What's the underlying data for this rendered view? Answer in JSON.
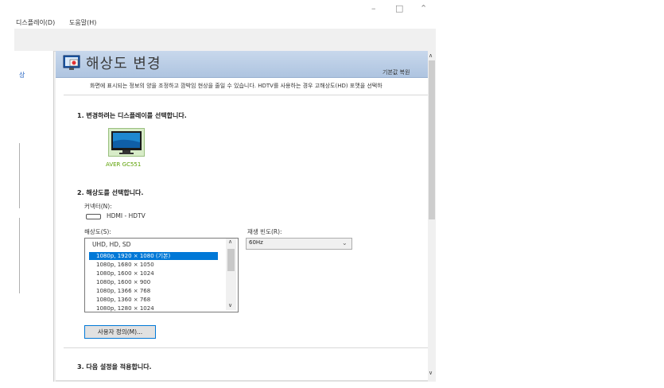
{
  "window": {
    "minimize": "–",
    "maximize": "□",
    "close": "⌃"
  },
  "menu": {
    "display": "디스플레이(D)",
    "help": "도움말(H)"
  },
  "sidebar": {
    "link": "상"
  },
  "header": {
    "title": "해상도 변경",
    "restore_defaults": "기본값 복원"
  },
  "description": "화면에 표시되는 정보의 양을 조정하고 깜박임 현상을 줄일 수 있습니다. HDTV를 사용하는 경우 고해상도(HD) 포맷을 선택하",
  "section1": {
    "title": "1. 변경하려는 디스플레이를 선택합니다.",
    "monitor_label": "AVER GC551"
  },
  "section2": {
    "title": "2. 해상도를 선택합니다.",
    "connector_label": "커넥터(N):",
    "connector_value": "HDMI - HDTV",
    "resolution_label": "해상도(S):",
    "refresh_label": "재생 빈도(R):",
    "resolution_group": "UHD, HD, SD",
    "resolutions": [
      "1080p, 1920 × 1080 (기본)",
      "1080p, 1680 × 1050",
      "1080p, 1600 × 1024",
      "1080p, 1600 × 900",
      "1080p, 1366 × 768",
      "1080p, 1360 × 768",
      "1080p, 1280 × 1024"
    ],
    "selected_index": 0,
    "refresh_value": "60Hz",
    "custom_button": "사용자 정의(M)..."
  },
  "section3": {
    "title": "3. 다음 설정을 적용합니다."
  },
  "colors": {
    "accent": "#0078d7",
    "header": "#b8cde6",
    "monitor_label": "#5aa000"
  },
  "icons": {
    "header": "display-settings-icon",
    "monitor": "monitor-icon",
    "connector": "hdmi-connector-icon"
  }
}
